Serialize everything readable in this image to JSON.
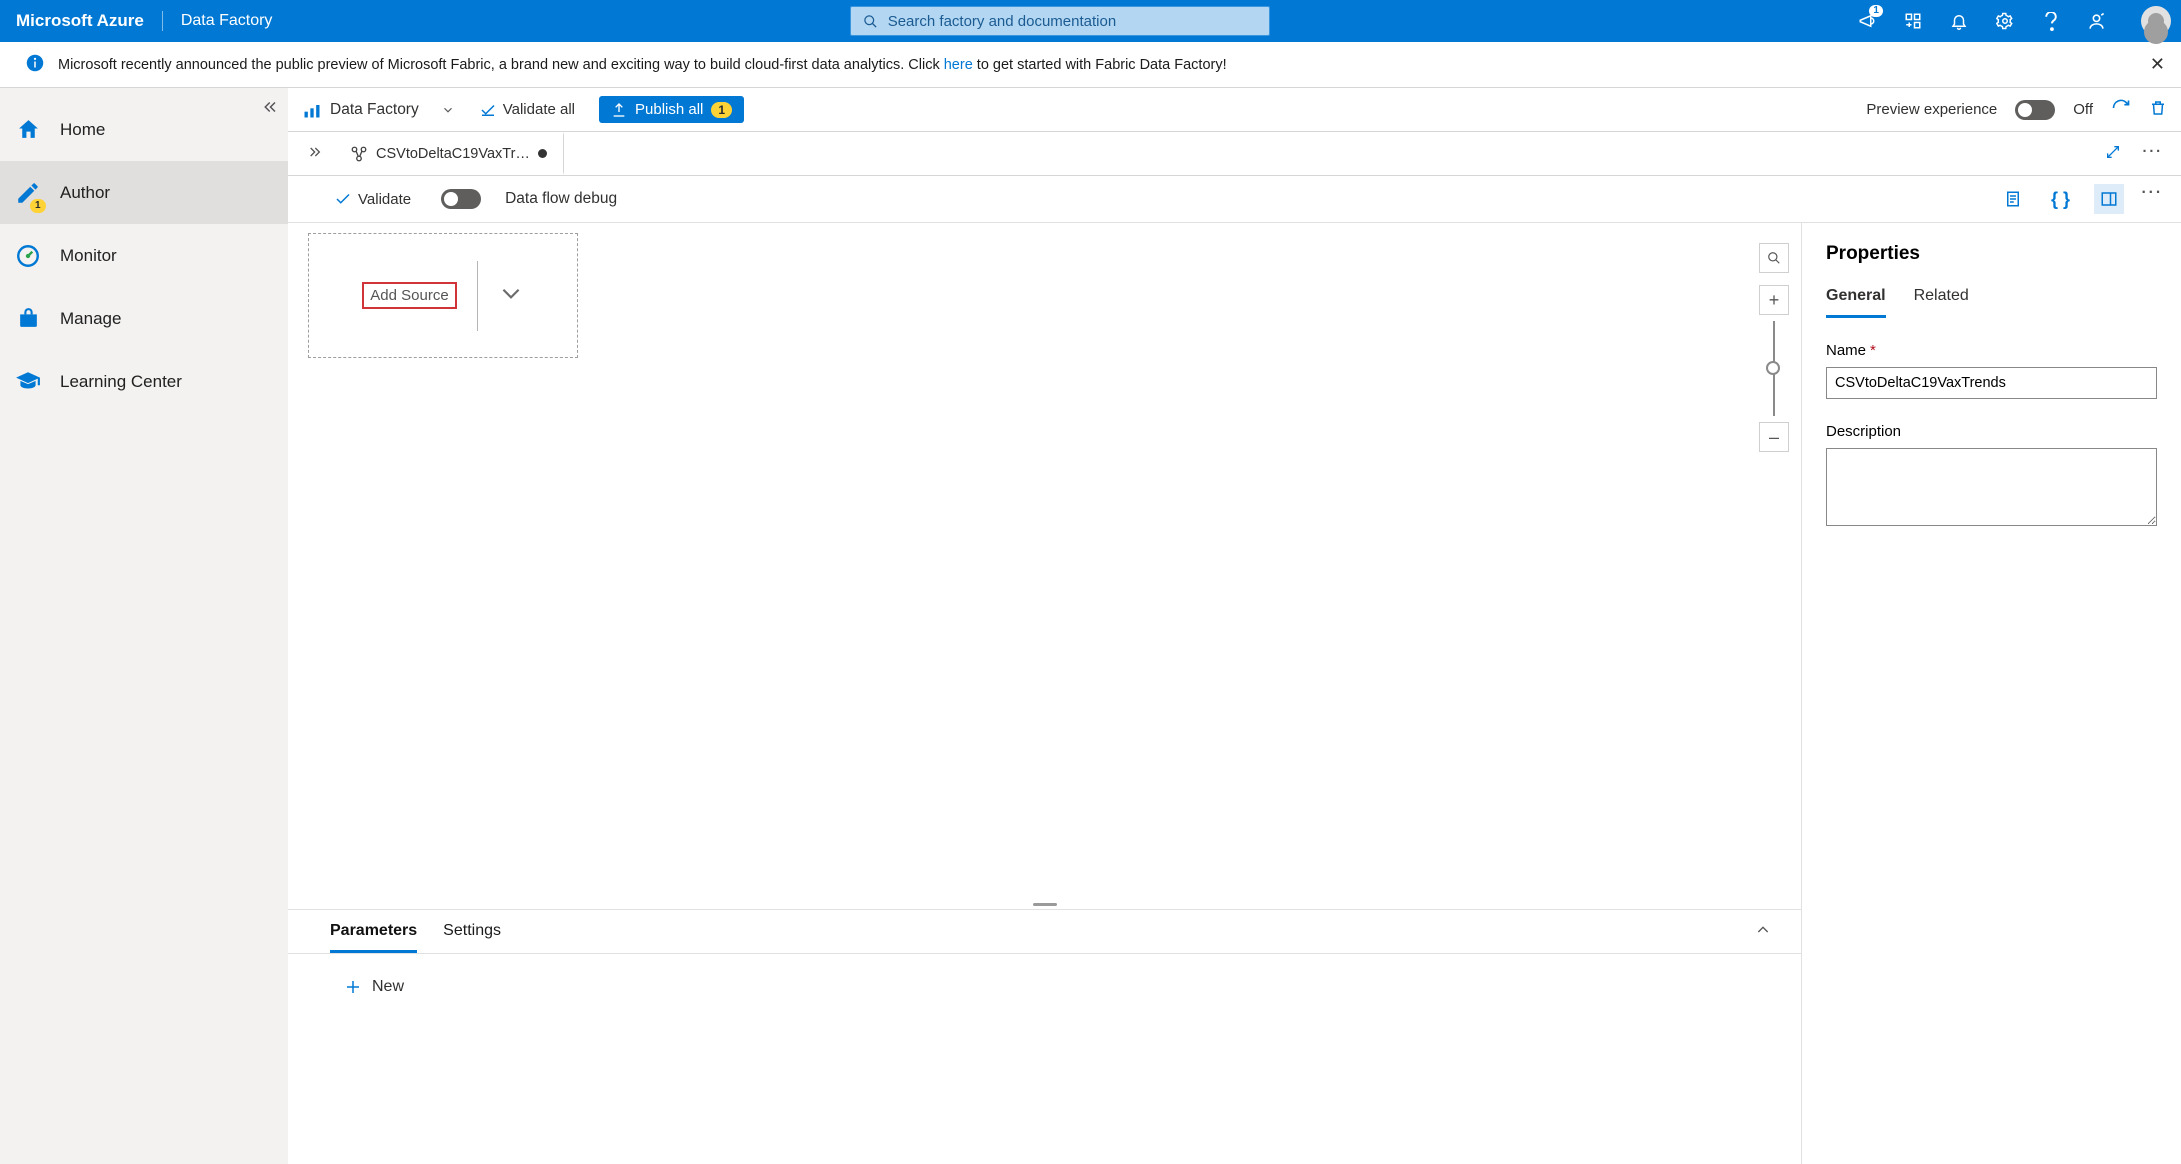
{
  "topbar": {
    "brand": "Microsoft Azure",
    "service": "Data Factory",
    "search_placeholder": "Search factory and documentation",
    "announce_badge": "1"
  },
  "banner": {
    "text_before": "Microsoft recently announced the public preview of Microsoft Fabric, a brand new and exciting way to build cloud-first data analytics. Click ",
    "link_text": "here",
    "text_after": " to get started with Fabric Data Factory!"
  },
  "sidebar": {
    "items": [
      {
        "label": "Home"
      },
      {
        "label": "Author",
        "badge": "1"
      },
      {
        "label": "Monitor"
      },
      {
        "label": "Manage"
      },
      {
        "label": "Learning Center"
      }
    ]
  },
  "maintoolbar": {
    "context": "Data Factory",
    "validate_all": "Validate all",
    "publish_all": "Publish all",
    "publish_count": "1",
    "preview_label": "Preview experience",
    "preview_state": "Off"
  },
  "tab": {
    "title": "CSVtoDeltaC19VaxTr…"
  },
  "flowbar": {
    "validate": "Validate",
    "debug": "Data flow debug"
  },
  "canvas": {
    "add_source": "Add Source"
  },
  "bottompanel": {
    "tabs": [
      "Parameters",
      "Settings"
    ],
    "new_label": "New"
  },
  "properties": {
    "title": "Properties",
    "tabs": [
      "General",
      "Related"
    ],
    "name_label": "Name",
    "name_value": "CSVtoDeltaC19VaxTrends",
    "desc_label": "Description"
  }
}
